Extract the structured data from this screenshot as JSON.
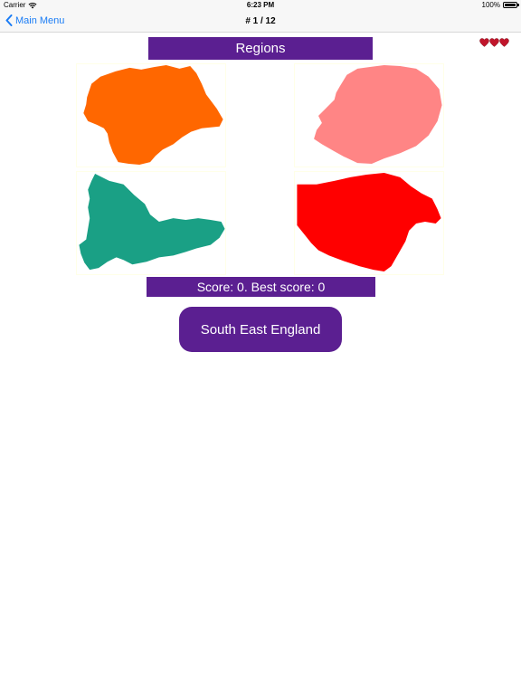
{
  "status": {
    "carrier": "Carrier",
    "time": "6:23 PM",
    "battery": "100%"
  },
  "nav": {
    "back_label": "Main Menu",
    "title": "# 1 / 12"
  },
  "game": {
    "title": "Regions",
    "lives": 3,
    "score_text": "Score: 0. Best score: 0",
    "answer_label": "South East England"
  },
  "colors": {
    "banner": "#5b1f91",
    "link": "#1a7cf5",
    "heart": "#c0152b",
    "region_orange": "#ff6700",
    "region_pink": "#ff8585",
    "region_teal": "#1aa085",
    "region_red": "#ff0000"
  },
  "icons": {
    "back": "chevron-left-icon",
    "wifi": "wifi-icon",
    "battery": "battery-icon",
    "heart": "heart-icon"
  }
}
